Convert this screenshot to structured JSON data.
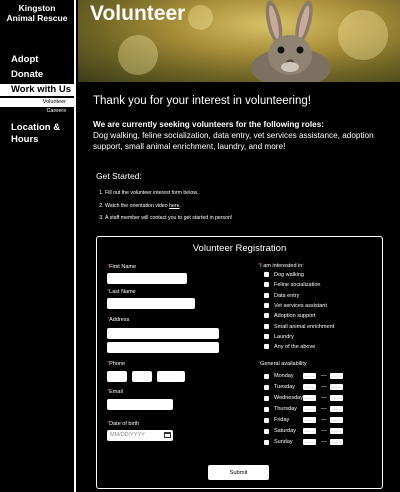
{
  "org": {
    "name_line1": "Kingston",
    "name_line2": "Animal Rescue"
  },
  "nav": {
    "items": [
      {
        "label": "Adopt"
      },
      {
        "label": "Donate"
      },
      {
        "label": "Work with Us"
      },
      {
        "label": "Location & Hours"
      }
    ],
    "work_sub": [
      {
        "label": "Volunteer"
      },
      {
        "label": "Careers"
      }
    ]
  },
  "header": {
    "title": "Volunteer"
  },
  "content": {
    "thanks": "Thank you for your interest in volunteering!",
    "seeking": "We are currently seeking volunteers for the following roles:",
    "roles": "Dog walking, feline socialization, data entry, vet services assistance, adoption support, small animal enrichment, laundry, and more!",
    "getting_started_title": "Get Started:",
    "step1": "Fill out the volunteer interest form below.",
    "step2_prefix": "Watch the orientation video ",
    "step2_link": "here",
    "step2_suffix": ".",
    "step3": "A staff member will contact you to get started in person!"
  },
  "form": {
    "title": "Volunteer Registration",
    "first_name_label": "First Name",
    "last_name_label": "Last Name",
    "address_label": "Address",
    "phone_label": "Phone",
    "email_label": "Email",
    "dob_label": "Date of birth",
    "dob_placeholder": "MM/DD/YYYY",
    "required_mark": "*",
    "interests_label": "I am interested in:",
    "interests": [
      "Dog walking",
      "Feline socialization",
      "Data entry",
      "Vet services assistant",
      "Adoption support",
      "Small animal enrichment",
      "Laundry",
      "Any of the above"
    ],
    "availability_label": "General availability",
    "days": [
      "Monday",
      "Tuesday",
      "Wednesday",
      "Thursday",
      "Friday",
      "Saturday",
      "Sunday"
    ],
    "time_placeholder": "--:-- --",
    "dash": "—",
    "submit_label": "Submit"
  }
}
